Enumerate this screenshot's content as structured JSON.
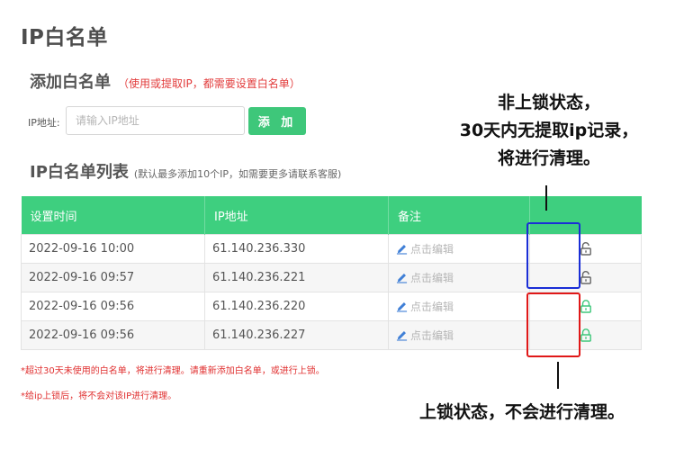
{
  "page": {
    "title": "IP白名单"
  },
  "add_section": {
    "title": "添加白名单",
    "note": "（使用或提取IP，都需要设置白名单）",
    "ip_label": "IP地址:",
    "input_placeholder": "请输入IP地址",
    "input_value": "",
    "add_button": "添 加"
  },
  "list_section": {
    "title": "IP白名单列表",
    "note": "(默认最多添加10个IP，如需要更多请联系客服)"
  },
  "table": {
    "headers": [
      "设置时间",
      "IP地址",
      "备注",
      ""
    ],
    "rows": [
      {
        "time": "2022-09-16 10:00",
        "ip": "61.140.236.330",
        "remark": "点击编辑",
        "locked": false
      },
      {
        "time": "2022-09-16 09:57",
        "ip": "61.140.236.221",
        "remark": "点击编辑",
        "locked": false
      },
      {
        "time": "2022-09-16 09:56",
        "ip": "61.140.236.220",
        "remark": "点击编辑",
        "locked": true
      },
      {
        "time": "2022-09-16 09:56",
        "ip": "61.140.236.227",
        "remark": "点击编辑",
        "locked": true
      }
    ]
  },
  "footnotes": [
    "*超过30天未使用的白名单，将进行清理。请重新添加白名单，或进行上锁。",
    "*给ip上锁后，将不会对该IP进行清理。"
  ],
  "annotations": {
    "unlocked_lines": [
      "非上锁状态，",
      "30天内无提取ip记录，",
      "将进行清理。"
    ],
    "locked_line": "上锁状态，不会进行清理。"
  },
  "colors": {
    "accent_green": "#3ecf7f",
    "unlocked_highlight": "#1a2ed6",
    "locked_highlight": "#e01818",
    "note_red": "#e23b3b"
  },
  "icons": {
    "remark_edit": "pencil-icon",
    "unlocked": "lock-open-icon",
    "locked": "lock-closed-icon"
  }
}
